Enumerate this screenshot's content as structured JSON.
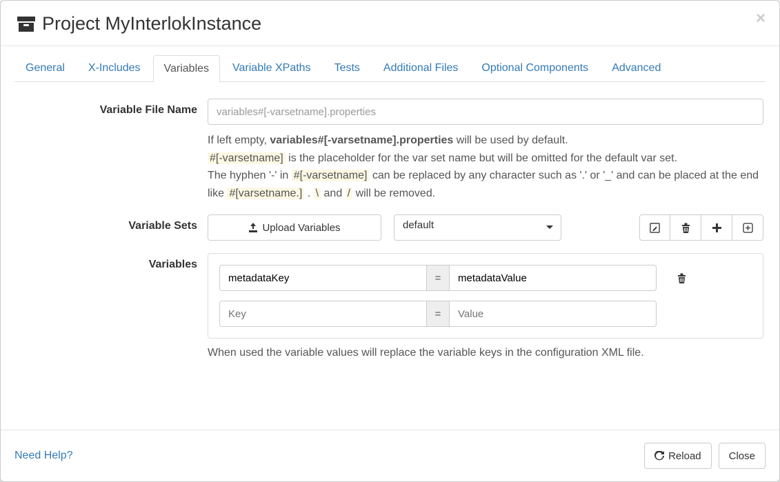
{
  "header": {
    "title": "Project MyInterlokInstance"
  },
  "tabs": [
    {
      "label": "General",
      "active": false
    },
    {
      "label": "X-Includes",
      "active": false
    },
    {
      "label": "Variables",
      "active": true
    },
    {
      "label": "Variable XPaths",
      "active": false
    },
    {
      "label": "Tests",
      "active": false
    },
    {
      "label": "Additional Files",
      "active": false
    },
    {
      "label": "Optional Components",
      "active": false
    },
    {
      "label": "Advanced",
      "active": false
    }
  ],
  "labels": {
    "variableFileName": "Variable File Name",
    "variableSets": "Variable Sets",
    "variables": "Variables"
  },
  "fileName": {
    "value": "",
    "placeholder": "variables#[-varsetname].properties"
  },
  "helpText": {
    "prefix1": "If left empty, ",
    "bold1": "variables#[-varsetname].properties",
    "suffix1": " will be used by default.",
    "code1": "#[-varsetname]",
    "mid1": " is the placeholder for the var set name but will be omitted for the default var set.",
    "line3a": "The hyphen '-' in ",
    "code2": "#[-varsetname]",
    "line3b": " can be replaced by any character such as '.' or '_' and can be placed at the end like ",
    "code3": "#[varsetname.]",
    "line3c": " . ",
    "code4": "\\",
    "line3d": " and ",
    "code5": "/",
    "line3e": " will be removed."
  },
  "sets": {
    "uploadLabel": "Upload Variables",
    "selected": "default"
  },
  "variables": {
    "rows": [
      {
        "key": "metadataKey",
        "value": "metadataValue"
      }
    ],
    "placeholderKey": "Key",
    "placeholderValue": "Value",
    "eq": "=",
    "footnote": "When used the variable values will replace the variable keys in the configuration XML file."
  },
  "footer": {
    "help": "Need Help?",
    "reload": "Reload",
    "close": "Close"
  }
}
